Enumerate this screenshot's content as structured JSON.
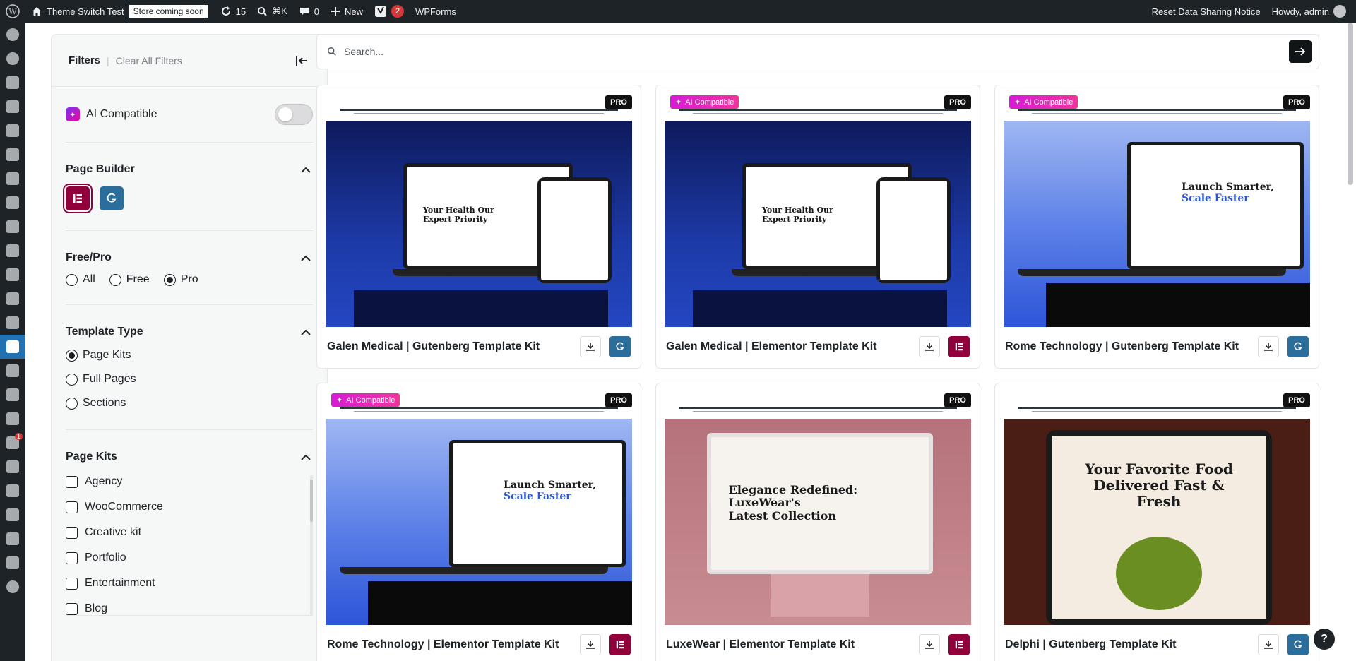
{
  "adminbar": {
    "site_name": "Theme Switch Test",
    "store_badge": "Store coming soon",
    "updates_count": "15",
    "search_shortcut": "⌘K",
    "comments_count": "0",
    "new_label": "New",
    "yoast_count": "2",
    "wpforms_label": "WPForms",
    "reset_notice": "Reset Data Sharing Notice",
    "howdy": "Howdy, admin"
  },
  "adminmenu": {
    "badge_count": "1"
  },
  "filters": {
    "title": "Filters",
    "clear_all": "Clear All Filters",
    "ai_compatible_label": "AI Compatible",
    "ai_compatible_enabled": false,
    "page_builder": {
      "title": "Page Builder"
    },
    "free_pro": {
      "title": "Free/Pro",
      "options": [
        "All",
        "Free",
        "Pro"
      ],
      "selected": "Pro"
    },
    "template_type": {
      "title": "Template Type",
      "options": [
        "Page Kits",
        "Full Pages",
        "Sections"
      ],
      "selected": "Page Kits"
    },
    "page_kits": {
      "title": "Page Kits",
      "options": [
        "Agency",
        "WooCommerce",
        "Creative kit",
        "Portfolio",
        "Entertainment",
        "Blog"
      ]
    }
  },
  "search": {
    "placeholder": "Search..."
  },
  "cards": [
    {
      "title": "Galen Medical | Gutenberg Template Kit",
      "badge": "PRO",
      "ai": false,
      "builder": "gutenberg",
      "screen_line1": "Your Health Our",
      "screen_line2": "Expert Priority"
    },
    {
      "title": "Galen Medical | Elementor Template Kit",
      "badge": "PRO",
      "ai": true,
      "ai_label": "AI Compatible",
      "builder": "elementor",
      "screen_line1": "Your Health Our",
      "screen_line2": "Expert Priority"
    },
    {
      "title": "Rome Technology | Gutenberg Template Kit",
      "badge": "PRO",
      "ai": true,
      "ai_label": "AI Compatible",
      "builder": "gutenberg",
      "screen_line1": "Launch Smarter,",
      "screen_line2": "Scale Faster"
    },
    {
      "title": "Rome Technology | Elementor Template Kit",
      "badge": "PRO",
      "ai": true,
      "ai_label": "AI Compatible",
      "builder": "elementor",
      "screen_line1": "Launch Smarter,",
      "screen_line2": "Scale Faster"
    },
    {
      "title": "LuxeWear | Elementor Template Kit",
      "badge": "PRO",
      "ai": false,
      "builder": "elementor",
      "screen_line1": "Elegance Redefined: LuxeWear's",
      "screen_line2": "Latest Collection"
    },
    {
      "title": "Delphi | Gutenberg Template Kit",
      "badge": "PRO",
      "ai": false,
      "builder": "gutenberg",
      "screen_line1": "Your Favorite Food",
      "screen_line2": "Delivered Fast & Fresh"
    }
  ],
  "colors": {
    "elementor": "#92003b",
    "gutenberg": "#2c6e9b",
    "admin_bar": "#1d2327",
    "ai_badge": "#e8249f"
  }
}
